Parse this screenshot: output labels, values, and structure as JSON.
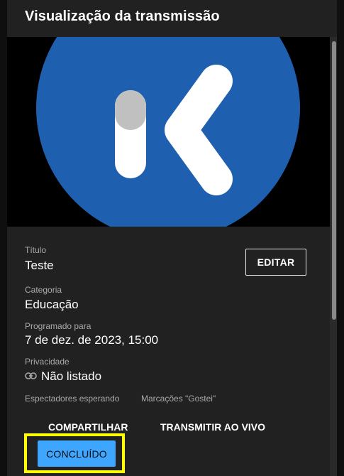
{
  "dialog": {
    "title": "Visualização da transmissão"
  },
  "colors": {
    "logo_circle": "#1f5fb0",
    "logo_mark": "#ffffff",
    "logo_knob": "#c0c0c0",
    "accent_button": "#3ea6ff",
    "highlight_box": "#ffff00"
  },
  "details": {
    "title_label": "Título",
    "title_value": "Teste",
    "category_label": "Categoria",
    "category_value": "Educação",
    "scheduled_label": "Programado para",
    "scheduled_value": "7 de dez. de 2023, 15:00",
    "privacy_label": "Privacidade",
    "privacy_value": "Não listado",
    "privacy_icon": "link-icon"
  },
  "stats": {
    "waiting_label": "Espectadores esperando",
    "likes_label": "Marcações \"Gostei\""
  },
  "actions": {
    "edit_label": "EDITAR",
    "share_label": "COMPARTILHAR",
    "go_live_label": "TRANSMITIR AO VIVO",
    "done_label": "CONCLUÍDO"
  }
}
